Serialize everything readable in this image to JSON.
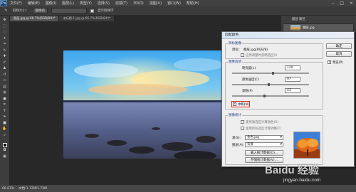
{
  "app": {
    "logo": "Ps"
  },
  "menubar": {
    "items": [
      "文件(F)",
      "编辑(E)",
      "图像(I)",
      "图层(L)",
      "类型(Y)",
      "选择(S)",
      "滤镜(T)",
      "3D(D)",
      "视图(V)",
      "窗口(W)",
      "帮助(H)"
    ]
  },
  "options": {
    "sample_label": "取样大小：",
    "sample_value": "取样点",
    "sample_all_label": "对所有图层取样",
    "display_label": "显示取样环"
  },
  "tabs": [
    {
      "label": "图层.jpg @ 66.7%(RGB/8#)*"
    },
    {
      "label": "未标题-1.jpg @ 66.7%(RGB/8#)*"
    }
  ],
  "layers_panel": {
    "tab": "图层 路径",
    "layer_name": "图层.jpg"
  },
  "status": {
    "zoom": "66.67%",
    "doc": "文档:1.72M/1.72M"
  },
  "dialog": {
    "title": "匹配颜色",
    "target_group": "目标图像",
    "target_label": "目标：",
    "target_value": "图层.jpg(RGB/8)",
    "ignore_selection": "应用调整时忽略选区(I)",
    "image_options": "图像选项",
    "luminance_label": "明亮度(L)",
    "luminance_value": "120",
    "color_intensity_label": "颜色强度(C)",
    "color_intensity_value": "97",
    "fade_label": "渐隐(F)",
    "fade_value": "43",
    "neutralize_label": "中和(N)",
    "image_stats": "图像统计",
    "use_selection_source": "使用源选区计算颜色(R)",
    "use_selection_target": "使用目标选区计算调整(T)",
    "source_label": "源(S)：",
    "source_value": "金色.jpg",
    "layer_label": "图层(A)：",
    "layer_value": "背景",
    "load_stats": "载入统计数据(O)...",
    "save_stats": "存储统计数据(V)...",
    "ok": "确定",
    "cancel": "取消",
    "preview": "预览(P)"
  },
  "watermark": {
    "main": "Baidu 经验",
    "sub": "jingyan.baidu.com"
  }
}
